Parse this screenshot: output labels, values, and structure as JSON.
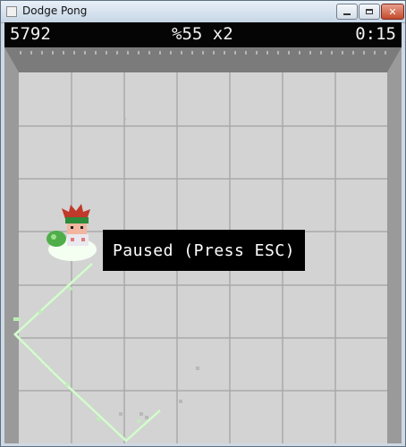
{
  "window": {
    "title": "Dodge Pong"
  },
  "hud": {
    "score": "5792",
    "percent_multiplier": "%55 x2",
    "timer": "0:15"
  },
  "overlay": {
    "paused_text": "Paused (Press ESC)"
  },
  "colors": {
    "floor": "#d3d3d3",
    "grid": "#a9a9a9",
    "wall": "#8e8e8e",
    "trail": "#c8f2c2"
  },
  "icons": [
    "app-icon",
    "minimize-icon",
    "maximize-icon",
    "close-icon",
    "player-character"
  ]
}
